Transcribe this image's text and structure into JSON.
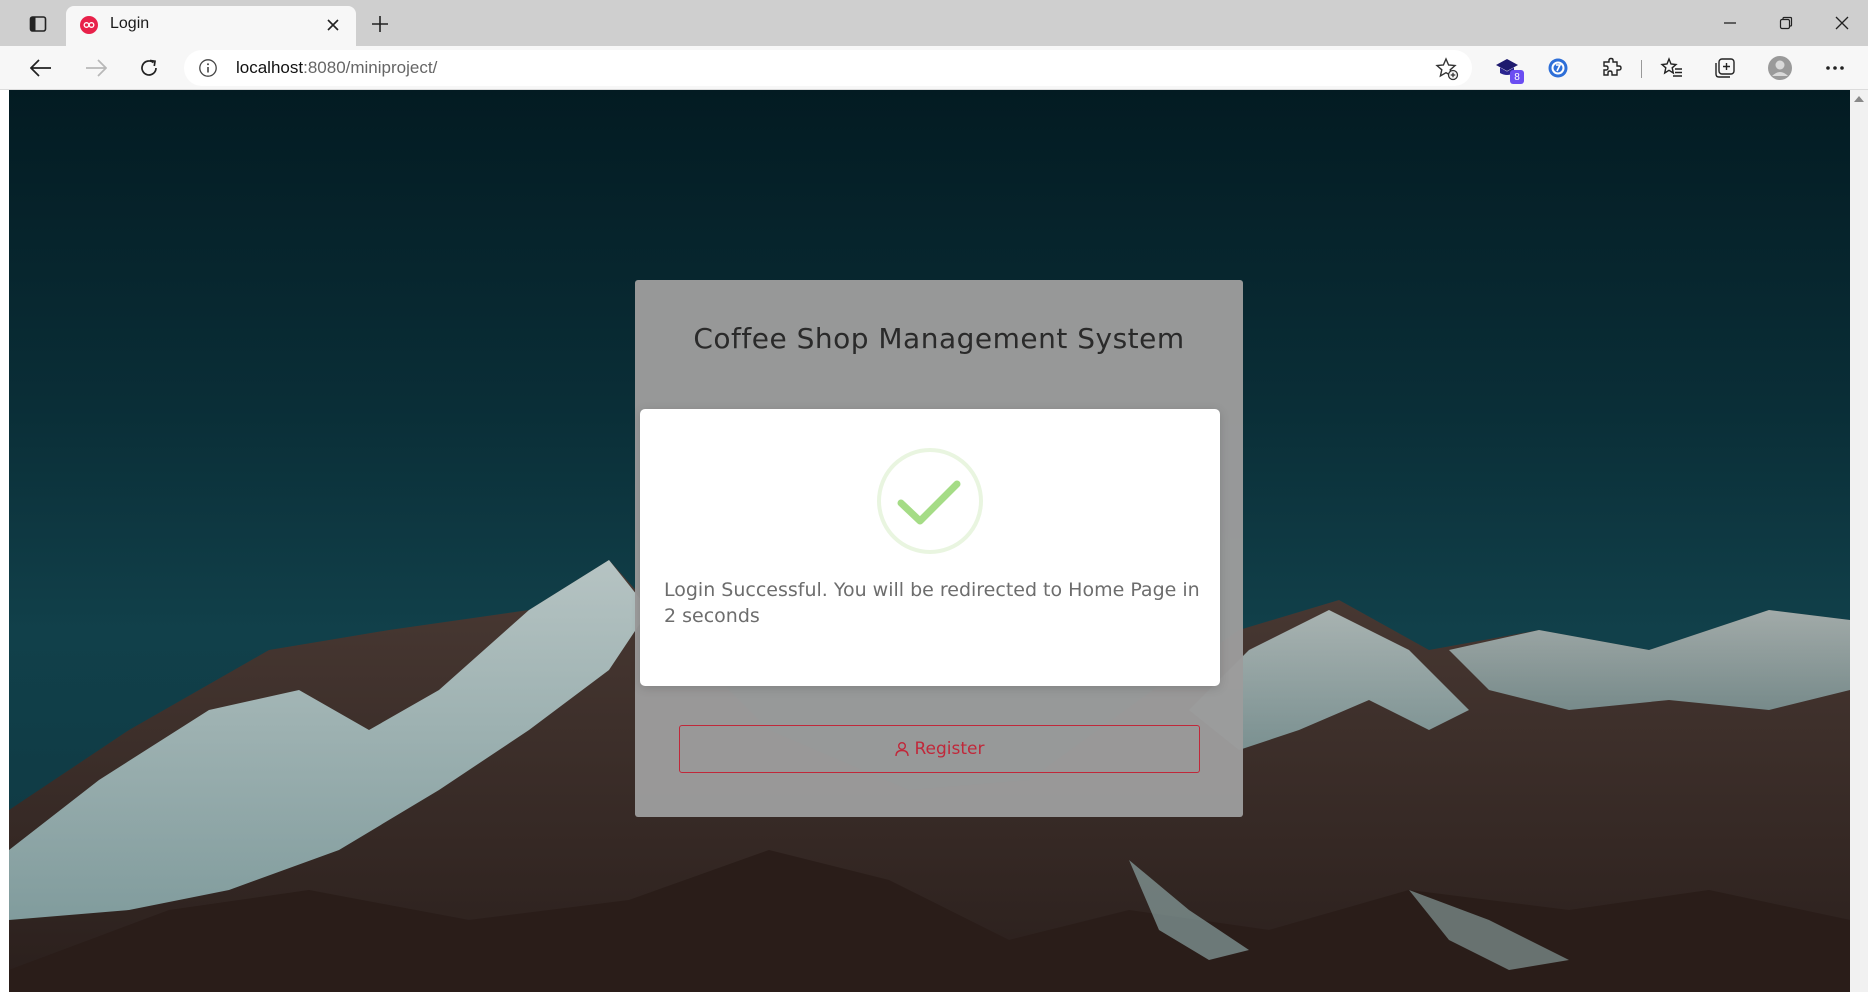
{
  "browser": {
    "tab_title": "Login",
    "url_host": "localhost",
    "url_path": ":8080/miniproject/",
    "extension_badge": "8"
  },
  "page": {
    "card_title": "Coffee Shop Management System",
    "register_label": "Register"
  },
  "modal": {
    "icon": "checkmark-success-icon",
    "message": "Login Successful. You will be redirected to Home Page in 2 seconds"
  },
  "colors": {
    "accent_red": "#c0283a",
    "success_green": "#a5dc86"
  }
}
